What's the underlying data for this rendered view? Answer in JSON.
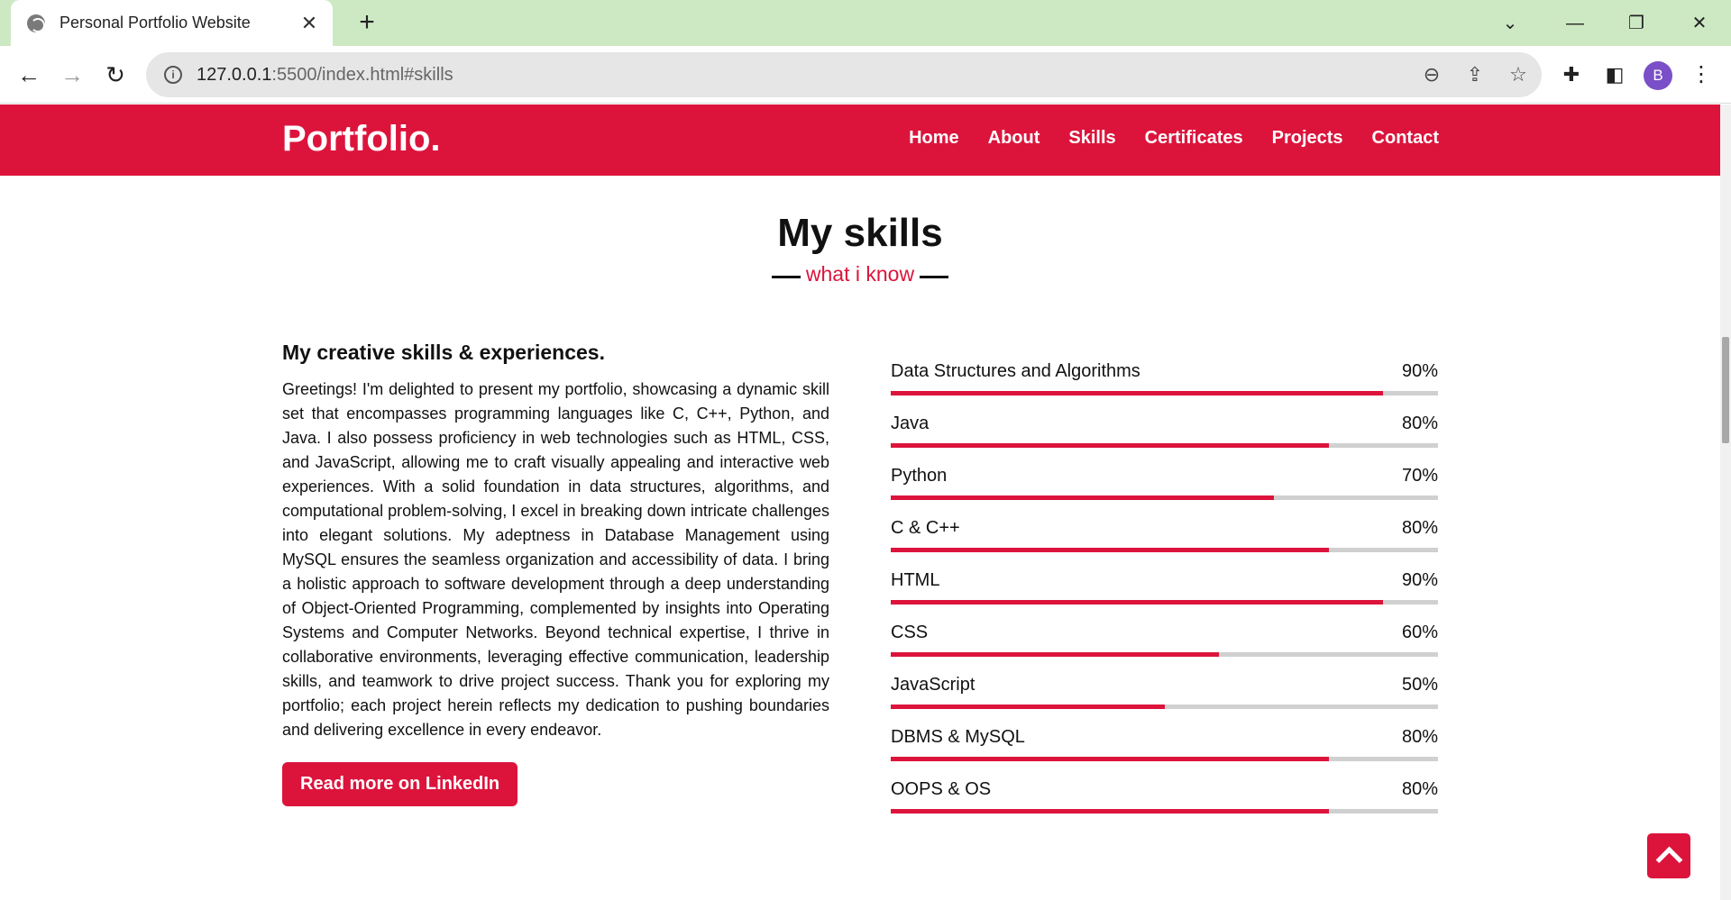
{
  "browser": {
    "tab_title": "Personal Portfolio Website",
    "tab_close": "✕",
    "new_tab": "+",
    "url_host": "127.0.0.1",
    "url_rest": ":5500/index.html#skills",
    "profile_initial": "B",
    "window_controls": {
      "minimize": "—",
      "restore": "❐",
      "close": "✕",
      "dropdown": "⌄"
    }
  },
  "site": {
    "logo": "Portfolio.",
    "nav": [
      "Home",
      "About",
      "Skills",
      "Certificates",
      "Projects",
      "Contact"
    ]
  },
  "skills_section": {
    "title": "My skills",
    "subtitle": "what i know",
    "heading": "My creative skills & experiences.",
    "paragraph": "Greetings! I'm delighted to present my portfolio, showcasing a dynamic skill set that encompasses programming languages like C, C++, Python, and Java. I also possess proficiency in web technologies such as HTML, CSS, and JavaScript, allowing me to craft visually appealing and interactive web experiences. With a solid foundation in data structures, algorithms, and computational problem-solving, I excel in breaking down intricate challenges into elegant solutions. My adeptness in Database Management using MySQL ensures the seamless organization and accessibility of data. I bring a holistic approach to software development through a deep understanding of Object-Oriented Programming, complemented by insights into Operating Systems and Computer Networks. Beyond technical expertise, I thrive in collaborative environments, leveraging effective communication, leadership skills, and teamwork to drive project success. Thank you for exploring my portfolio; each project herein reflects my dedication to pushing boundaries and delivering excellence in every endeavor.",
    "cta_label": "Read more on LinkedIn",
    "skills": [
      {
        "name": "Data Structures and Algorithms",
        "percent_label": "90%",
        "value": 90
      },
      {
        "name": "Java",
        "percent_label": "80%",
        "value": 80
      },
      {
        "name": "Python",
        "percent_label": "70%",
        "value": 70
      },
      {
        "name": "C & C++",
        "percent_label": "80%",
        "value": 80
      },
      {
        "name": "HTML",
        "percent_label": "90%",
        "value": 90
      },
      {
        "name": "CSS",
        "percent_label": "60%",
        "value": 60
      },
      {
        "name": "JavaScript",
        "percent_label": "50%",
        "value": 50
      },
      {
        "name": "DBMS & MySQL",
        "percent_label": "80%",
        "value": 80
      },
      {
        "name": "OOPS & OS",
        "percent_label": "80%",
        "value": 80
      }
    ]
  },
  "colors": {
    "accent": "#dc143c",
    "track": "#d0d0d0",
    "tabstrip": "#cde9c4"
  }
}
